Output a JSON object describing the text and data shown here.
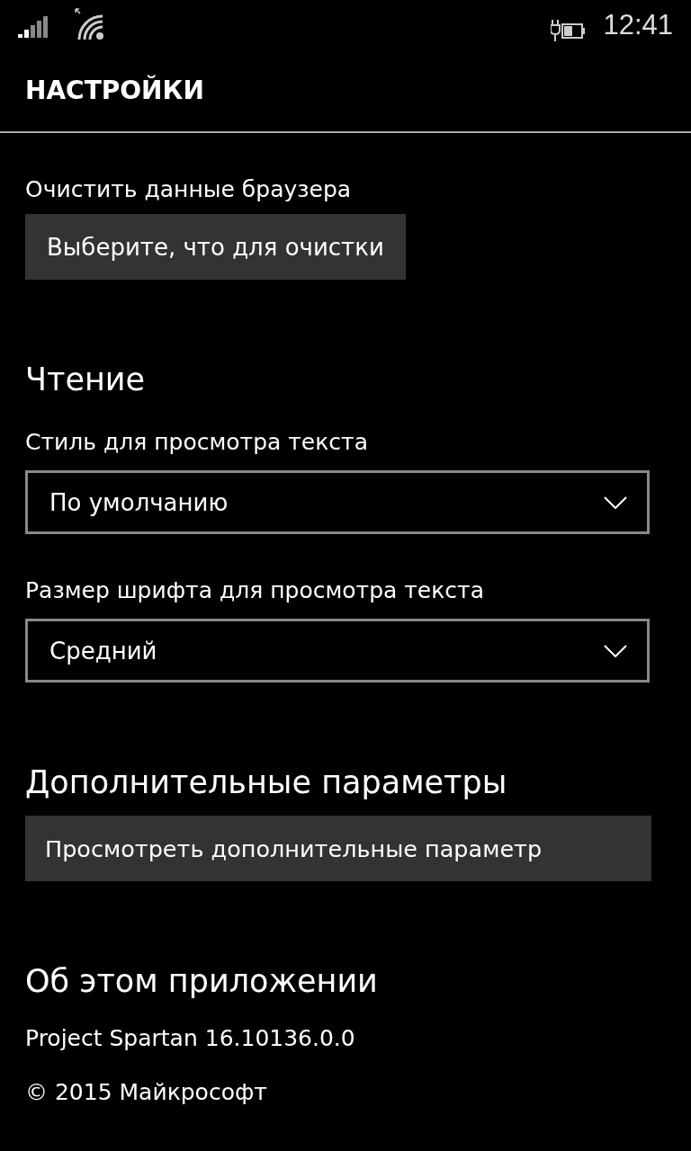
{
  "status_bar": {
    "time": "12:41"
  },
  "title": "НАСТРОЙКИ",
  "items": [
    {
      "kind": "label",
      "text": "Очистить данные браузера"
    },
    {
      "kind": "button",
      "text": "Выберите, что для очистки"
    },
    {
      "kind": "heading",
      "text": "Чтение"
    },
    {
      "kind": "label",
      "text": "Стиль для просмотра текста"
    },
    {
      "kind": "dropdown",
      "text": "По умолчанию"
    },
    {
      "kind": "label",
      "text": "Размер шрифта для просмотра текста"
    },
    {
      "kind": "dropdown",
      "text": "Средний"
    },
    {
      "kind": "heading",
      "text": "Дополнительные параметры"
    },
    {
      "kind": "wide-button",
      "text": "Просмотреть дополнительные параметр"
    },
    {
      "kind": "heading",
      "text": "Об этом приложении"
    },
    {
      "kind": "text",
      "text": "Project Spartan 16.10136.0.0"
    },
    {
      "kind": "text",
      "text": "© 2015 Майкрософт"
    }
  ]
}
